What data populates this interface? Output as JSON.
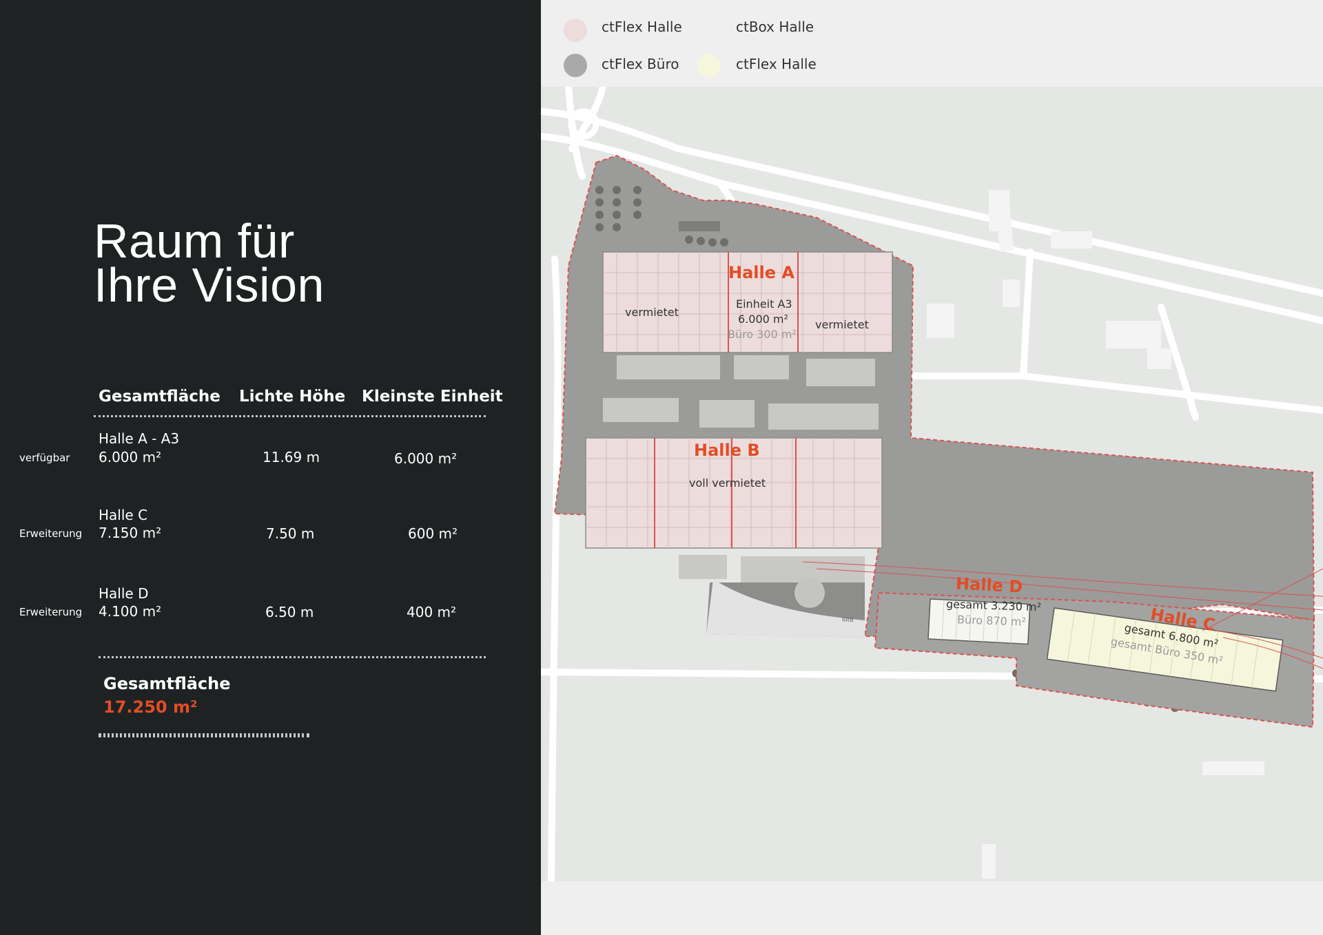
{
  "legend": [
    {
      "label": "ctFlex Halle",
      "color": "#ecdcdc"
    },
    {
      "label": "ctBox Halle",
      "color": ""
    },
    {
      "label": "ctFlex Büro",
      "color": "#a9a9a9"
    },
    {
      "label": "ctFlex Halle",
      "color": "#f6f6dc"
    }
  ],
  "headline": {
    "line1": "Raum für",
    "line2": "Ihre Vision"
  },
  "table": {
    "headers": [
      "Gesamtfläche",
      "Lichte Höhe",
      "Kleinste Einheit"
    ],
    "rows": [
      {
        "status": "verfügbar",
        "name": "Halle A - A3",
        "area": "6.000 m²",
        "height": "11.69 m",
        "smallest_unit": "6.000 m²"
      },
      {
        "status": "Erweiterung",
        "name": "Halle C",
        "area": "7.150 m²",
        "height": "7.50 m",
        "smallest_unit": "600 m²"
      },
      {
        "status": "Erweiterung",
        "name": "Halle D",
        "area": "4.100 m²",
        "height": "6.50 m",
        "smallest_unit": "400 m²"
      }
    ]
  },
  "total": {
    "label": "Gesamtfläche",
    "value": "17.250 m²"
  },
  "map": {
    "halle_a": {
      "title": "Halle A",
      "left_unit": "vermietet",
      "right_unit": "vermietet",
      "unit_a3_line1": "Einheit A3",
      "unit_a3_line2": "6.000 m²",
      "unit_a3_line3": "Büro 300 m²"
    },
    "halle_b": {
      "title": "Halle B",
      "status": "voll vermietet"
    },
    "halle_d": {
      "title": "Halle D",
      "line1": "gesamt 3.230 m²",
      "line2": "Büro 870 m²"
    },
    "halle_c": {
      "title": "Halle C",
      "line1": "gesamt 6.800 m²",
      "line2": "gesamt Büro 350 m²"
    },
    "rrb_label": "RRB"
  },
  "colors": {
    "accent": "#e24d26",
    "panel_dark": "#1e2223",
    "hall_fill": "#ecdcdc",
    "office_fill": "#f6f6dc"
  }
}
